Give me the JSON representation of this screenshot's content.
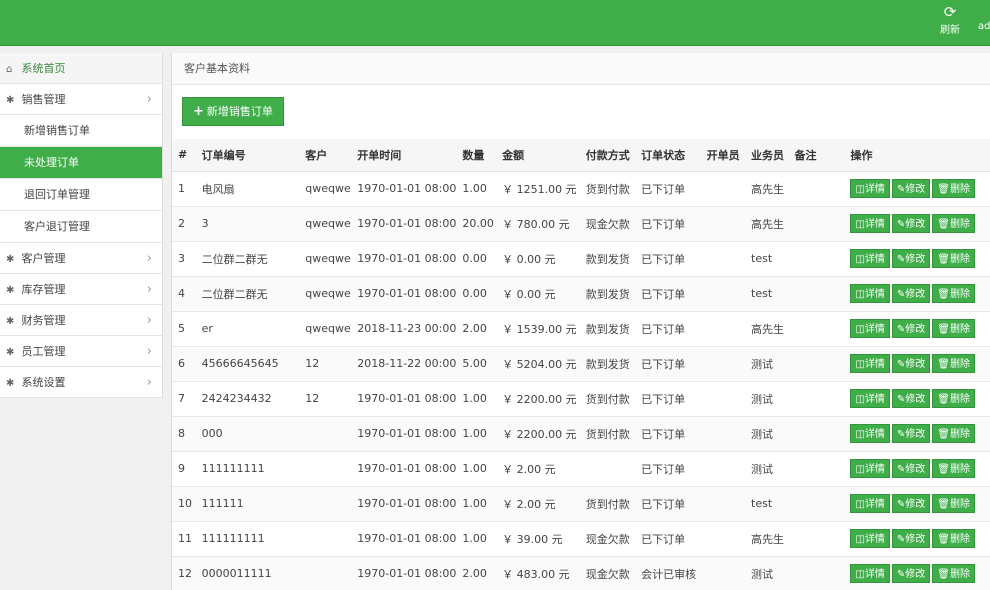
{
  "topbar": {
    "refresh_icon": "refresh-icon",
    "refresh_label": "刷新",
    "user_label": "ad"
  },
  "sidebar": {
    "home": "系统首页",
    "groups": [
      {
        "label": "销售管理",
        "expanded": true,
        "items": [
          "新增销售订单",
          "未处理订单",
          "退回订单管理",
          "客户退订管理"
        ],
        "active_index": 1
      },
      {
        "label": "客户管理"
      },
      {
        "label": "库存管理"
      },
      {
        "label": "财务管理"
      },
      {
        "label": "员工管理"
      },
      {
        "label": "系统设置"
      }
    ]
  },
  "content": {
    "breadcrumb": "客户基本资料",
    "add_button": "新增销售订单",
    "columns": [
      "#",
      "订单编号",
      "客户",
      "开单时间",
      "数量",
      "金额",
      "付款方式",
      "订单状态",
      "开单员",
      "业务员",
      "备注",
      "操作"
    ],
    "actions": {
      "detail": "详情",
      "edit": "修改",
      "delete": "删除"
    },
    "rows": [
      [
        "1",
        "电风扇",
        "qweqwe",
        "1970-01-01 08:00",
        "1.00",
        "￥ 1251.00 元",
        "货到付款",
        "已下订单",
        "",
        "高先生",
        ""
      ],
      [
        "2",
        "3",
        "qweqwe",
        "1970-01-01 08:00",
        "20.00",
        "￥ 780.00 元",
        "现金欠款",
        "已下订单",
        "",
        "高先生",
        ""
      ],
      [
        "3",
        "二位群二群无",
        "qweqwe",
        "1970-01-01 08:00",
        "0.00",
        "￥ 0.00 元",
        "款到发货",
        "已下订单",
        "",
        "test",
        ""
      ],
      [
        "4",
        "二位群二群无",
        "qweqwe",
        "1970-01-01 08:00",
        "0.00",
        "￥ 0.00 元",
        "款到发货",
        "已下订单",
        "",
        "test",
        ""
      ],
      [
        "5",
        "er",
        "qweqwe",
        "2018-11-23 00:00",
        "2.00",
        "￥ 1539.00 元",
        "款到发货",
        "已下订单",
        "",
        "高先生",
        ""
      ],
      [
        "6",
        "45666645645",
        "12",
        "2018-11-22 00:00",
        "5.00",
        "￥ 5204.00 元",
        "款到发货",
        "已下订单",
        "",
        "测试",
        ""
      ],
      [
        "7",
        "2424234432",
        "12",
        "1970-01-01 08:00",
        "1.00",
        "￥ 2200.00 元",
        "货到付款",
        "已下订单",
        "",
        "测试",
        ""
      ],
      [
        "8",
        "000",
        "",
        "1970-01-01 08:00",
        "1.00",
        "￥ 2200.00 元",
        "货到付款",
        "已下订单",
        "",
        "测试",
        ""
      ],
      [
        "9",
        "111111111",
        "",
        "1970-01-01 08:00",
        "1.00",
        "￥ 2.00 元",
        "",
        "已下订单",
        "",
        "测试",
        ""
      ],
      [
        "10",
        "111111",
        "",
        "1970-01-01 08:00",
        "1.00",
        "￥ 2.00 元",
        "货到付款",
        "已下订单",
        "",
        "test",
        ""
      ],
      [
        "11",
        "111111111",
        "",
        "1970-01-01 08:00",
        "1.00",
        "￥ 39.00 元",
        "现金欠款",
        "已下订单",
        "",
        "高先生",
        ""
      ],
      [
        "12",
        "0000011111",
        "",
        "1970-01-01 08:00",
        "2.00",
        "￥ 483.00 元",
        "现金欠款",
        "会计已审核",
        "",
        "测试",
        ""
      ]
    ]
  }
}
